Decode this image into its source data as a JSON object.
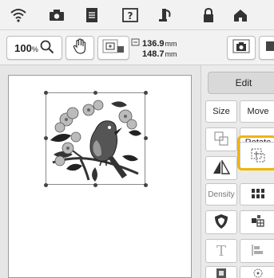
{
  "top_bar": {
    "icons": [
      "wifi-icon",
      "camera-icon",
      "document-icon",
      "help-icon",
      "thread-icon",
      "lock-icon",
      "home-icon"
    ]
  },
  "toolbar": {
    "zoom_value": "100",
    "zoom_unit": "%",
    "width_value": "136.9",
    "height_value": "148.7",
    "unit": "mm",
    "icons": [
      "zoom-icon",
      "hand-icon",
      "frame-icon",
      "camera-scan-icon"
    ]
  },
  "panel": {
    "edit_label": "Edit",
    "size_label": "Size",
    "move_label": "Move",
    "rotate_label": "Rotate",
    "density_label": "Density"
  },
  "colors": {
    "highlight": "#f1b400",
    "bar_bg": "#f2f2f2",
    "canvas_bg": "#e6e6e6"
  }
}
